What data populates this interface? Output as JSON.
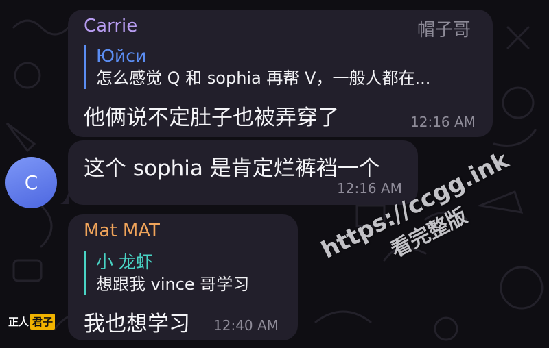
{
  "messages": [
    {
      "sender": "Carrie",
      "tag": "帽子哥",
      "reply_name": "Юйси",
      "reply_text": "怎么感觉 Q 和 sophia 再帮 V，一般人都在...",
      "text": "他俩说不定肚子也被弄穿了",
      "time": "12:16 AM",
      "sender_color": "#b79cf0",
      "reply_color": "#5b8df2"
    },
    {
      "text": "这个 sophia 是肯定烂裤裆一个",
      "time": "12:16 AM",
      "avatar_initial": "C"
    },
    {
      "sender": "Mat MAT",
      "reply_name": "小 龙虾",
      "reply_text": "想跟我 vince 哥学习",
      "text": "我也想学习",
      "time": "12:40 AM",
      "sender_color": "#f0a45a",
      "reply_color": "#49d3c4"
    }
  ],
  "watermark": {
    "line1": "https://ccgg.ink",
    "line2": "看完整版"
  },
  "logo": {
    "part1": "正人",
    "part2": "君子"
  }
}
